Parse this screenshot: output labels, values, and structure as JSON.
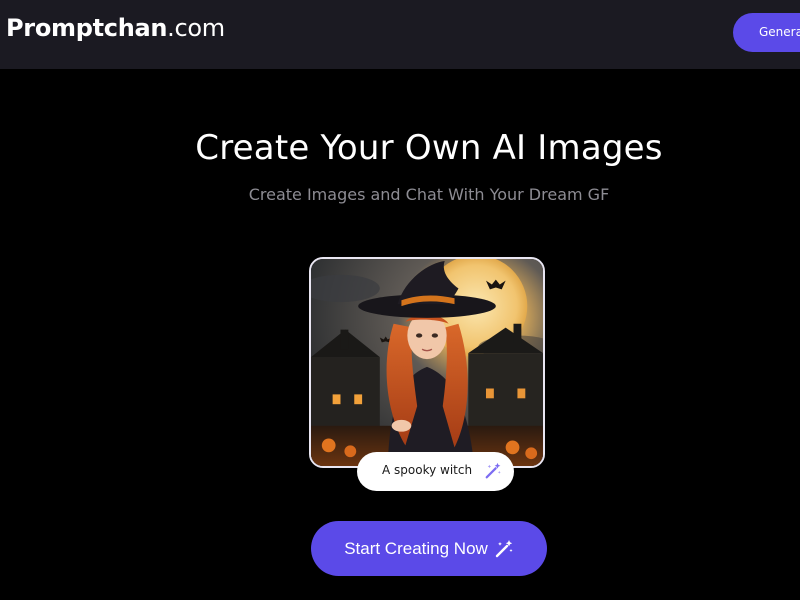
{
  "header": {
    "logo_brand": "Promptchan",
    "logo_tld": ".com",
    "generate_label": "Generate"
  },
  "hero": {
    "title": "Create Your Own AI Images",
    "subtitle": "Create Images and Chat With Your Dream GF"
  },
  "preview": {
    "image_alt": "Anime witch girl with orange hair and a black witch hat in front of a full moon, houses and pumpkins",
    "prompt_text": "A spooky witch",
    "prompt_icon": "magic-wand-icon"
  },
  "cta": {
    "label": "Start Creating Now",
    "icon": "magic-wand-icon"
  },
  "colors": {
    "background": "#000000",
    "header_bg": "#1b1a22",
    "accent": "#5b4ae8",
    "subtitle": "#8d8c93"
  }
}
